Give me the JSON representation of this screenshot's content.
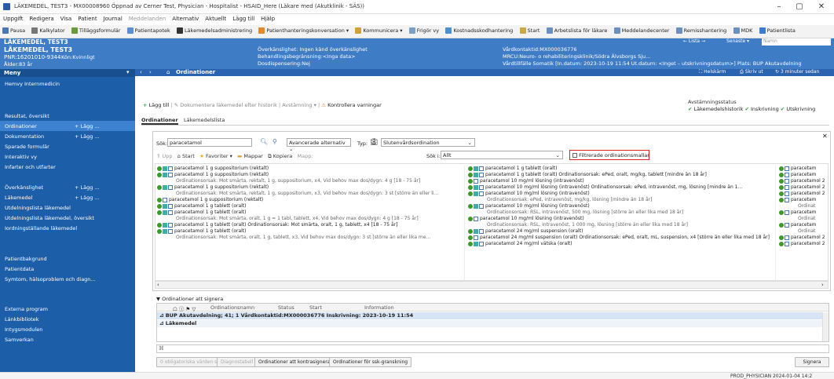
{
  "window": {
    "title": "LÄKEMEDEL, TEST3 - MX00008960 Öppnad av Cerner Test, Physician - Hospitalist - HSAID_Here (Läkare med (Akutklinik - SÄS))",
    "min": "–",
    "max": "▢",
    "close": "✕"
  },
  "menubar": {
    "items": [
      "Uppgift",
      "Redigera",
      "Visa",
      "Patient",
      "Journal"
    ],
    "disabled": "Meddelanden",
    "items2": [
      "Alternativ",
      "Aktuellt",
      "Lägg till",
      "Hjälp"
    ]
  },
  "toolbar": {
    "items": [
      "Pausa",
      "Kalkylator",
      "Tilläggsformulär",
      "Patientapotek",
      "Läkemedelsadministrering",
      "Patienthanteringskonversation ▾",
      "Kommunicera ▾",
      "Frigör vy",
      "Kostnadsskodhantering",
      "Start",
      "Arbetslista för läkare",
      "Meddelandecenter",
      "Remisshantering",
      "MDK",
      "Patientlista"
    ]
  },
  "patient": {
    "title": "LÄKEMEDEL, TEST3",
    "name": "LÄKEMEDEL, TEST3",
    "pnr": "PNR:16201010-9344",
    "gender": "Kön:Kvinnligt",
    "age": "Ålder:83 år",
    "allergy": "Överkänslighet: Ingen känd överkänslighet",
    "limit": "Behandlingsbegränsning:<Inga data>",
    "dosing": "Dosdispensering:Nej",
    "contact": "Vårdkontaktid:MX000036776",
    "unit": "MRCU:Neuro- o rehabiliteringsklinik/Södra Älvsborgs Sju...",
    "episode": "Vårdtillfälle Somatik [In.datum: 2023-10-19 11:54 Ut.datum: <Inget – utskrivningsdatum>] Plats: BUP Akutavdelning",
    "lista": "← Lista →",
    "senaste": "Senaste ▾",
    "namn": "Namn"
  },
  "nav": {
    "title": "Ordinationer",
    "helskarm": "Helskärm",
    "skriv": "Skriv ut",
    "updated": "3 minuter sedan"
  },
  "leftmenu": {
    "header": "Meny",
    "items": [
      {
        "label": "Hemvy Internmedicin",
        "add": ""
      },
      {
        "label": "Resultat, översikt",
        "add": ""
      },
      {
        "label": "Ordinationer",
        "add": "+ Lägg ..."
      },
      {
        "label": "Dokumentation",
        "add": "+ Lägg ..."
      },
      {
        "label": "Sparade formulär",
        "add": ""
      },
      {
        "label": "Interaktiv vy",
        "add": ""
      },
      {
        "label": "Infarter och utfarter",
        "add": ""
      },
      {
        "label": "Överkänslighet",
        "add": "+ Lägg ..."
      },
      {
        "label": "Läkemedel",
        "add": "+ Lägg ..."
      },
      {
        "label": "Utdelningslista läkemedel",
        "add": ""
      },
      {
        "label": "Utdelningslista läkemedel, översikt",
        "add": ""
      },
      {
        "label": "Iordningställande läkemedel",
        "add": ""
      },
      {
        "label": "Patientbakgrund",
        "add": ""
      },
      {
        "label": "Patientdata",
        "add": ""
      },
      {
        "label": "Symtom, hälsoproblem och diagn...",
        "add": ""
      },
      {
        "label": "Externa program",
        "add": ""
      },
      {
        "label": "Länkbibliotek",
        "add": ""
      },
      {
        "label": "Intygsmodulen",
        "add": ""
      },
      {
        "label": "Samverkan",
        "add": ""
      }
    ]
  },
  "actions": {
    "add": "Lägg till",
    "document": "Dokumentera läkemedel efter historik",
    "reconcile": "Avstämning ▾",
    "check": "Kontrollera varningar",
    "status_title": "Avstämningsstatus",
    "status1": "Läkemedelshistorik",
    "status2": "Inskrivning",
    "status3": "Utskrivning"
  },
  "tabs": [
    "Ordinationer",
    "Läkemedelslista"
  ],
  "search": {
    "label": "Sök:",
    "value": "paracetamol",
    "advanced": "Avancerade alternativ",
    "type_label": "Typ:",
    "type_value": "Slutenvårdsordination",
    "upp": "Upp",
    "start": "Start",
    "favoriter": "Favoriter ▾",
    "mappar": "Mappar",
    "kopiera": "Kopiera",
    "mapp": "Mapp:",
    "in_label": "Sök i:",
    "in_value": "Allt",
    "filter": "Filtrerade ordinationsmallar"
  },
  "results": {
    "col1": [
      {
        "t": "paracetamol 1 g suppositorium (rektalt)",
        "sub": false
      },
      {
        "t": "paracetamol 1 g suppositorium (rektalt)",
        "sub": false
      },
      {
        "t": "Ordinationsorsak: Mot smärta, rektalt, 1 g, suppositorium, x4, Vid behov max dos/dygn: 4 g [18 - 75 år]",
        "sub": true
      },
      {
        "t": "paracetamol 1 g suppositorium (rektalt)",
        "sub": false
      },
      {
        "t": "Ordinationsorsak: Mot smärta, rektalt, 1 g, suppositorium, x3, Vid behov max dos/dygn: 3 st [större än eller li...",
        "sub": true
      },
      {
        "t": "paracetamol 1 g suppositorium (rektalt)",
        "sub": false
      },
      {
        "t": "paracetamol 1 g tablett (oralt)",
        "sub": false
      },
      {
        "t": "paracetamol 1 g tablett (oralt)",
        "sub": false
      },
      {
        "t": "Ordinationsorsak: Mot smärta, oralt, 1 g = 1 tabl, tablett, x4, Vid behov max dos/dygn: 4 g [18 - 75 år]",
        "sub": true
      },
      {
        "t": "paracetamol 1 g tablett (oralt)  Ordinationsorsak: Mot smärta, oralt, 1 g, tablett, x4 [18 - 75 år]",
        "sub": false
      },
      {
        "t": "paracetamol 1 g tablett (oralt)",
        "sub": false
      },
      {
        "t": "Ordinationsorsak: Mot smärta, oralt, 1 g, tablett, x3, Vid behov max dos/dygn: 3 st [större än eller lika me...",
        "sub": true
      }
    ],
    "col2": [
      {
        "t": "paracetamol 1 g tablett (oralt)",
        "sub": false
      },
      {
        "t": "paracetamol 1 g tablett (oralt)  Ordinationsorsak: ePed, oralt, mg/kg, tablett [mindre än 18 år]",
        "sub": false
      },
      {
        "t": "paracetamol 10 mg/ml lösning (intravenöst)",
        "sub": false
      },
      {
        "t": "paracetamol 10 mg/ml lösning (intravenöst)  Ordinationsorsak: ePed, intravenöst, mg, lösning [mindre än 1...",
        "sub": false
      },
      {
        "t": "paracetamol 10 mg/ml lösning (intravenöst)",
        "sub": false
      },
      {
        "t": "Ordinationsorsak: ePed, intravenöst, mg/kg, lösning [mindre än 18 år]",
        "sub": true
      },
      {
        "t": "paracetamol 10 mg/ml lösning (intravenöst)",
        "sub": false
      },
      {
        "t": "Ordinationsorsak: RSL, intravenöst, 500 mg, lösning [större än eller lika med 18 år]",
        "sub": true
      },
      {
        "t": "paracetamol 10 mg/ml lösning (intravenöst)",
        "sub": false
      },
      {
        "t": "Ordinationsorsak: RSL, intravenöst, 1 000 mg, lösning [större än eller lika med 18 år]",
        "sub": true
      },
      {
        "t": "paracetamol 24 mg/ml suspension (oralt)",
        "sub": false
      },
      {
        "t": "paracetamol 24 mg/ml suspension (oralt)  Ordinationsorsak: ePed, oralt, mL, suspension, x4 [större än eller lika med 18 år]",
        "sub": false
      },
      {
        "t": "paracetamol 24 mg/ml vätska (oralt)",
        "sub": false
      }
    ],
    "col3": [
      {
        "t": "paracetam",
        "sub": false
      },
      {
        "t": "paracetam",
        "sub": false
      },
      {
        "t": "paracetamol 2",
        "sub": false
      },
      {
        "t": "paracetamol 2",
        "sub": false
      },
      {
        "t": "paracetamol 2",
        "sub": false
      },
      {
        "t": "paracetam",
        "sub": false
      },
      {
        "t": "Ordinat",
        "sub": true
      },
      {
        "t": "paracetam",
        "sub": false
      },
      {
        "t": "Ordinat",
        "sub": true
      },
      {
        "t": "paracetam",
        "sub": false
      },
      {
        "t": "Ordinat",
        "sub": true
      },
      {
        "t": "paracetamol 2",
        "sub": false
      },
      {
        "t": "paracetamol 2",
        "sub": false
      }
    ]
  },
  "sign": {
    "title": "Ordinationer att signera",
    "cols": [
      "Ordinationsnamn",
      "Status",
      "Start",
      "Information"
    ],
    "group": "BUP Akutavdelning; 41; 1 Vårdkontaktid:MX000036776 Inskrivning: 2023-10-19 11:54",
    "sub": "Läkemedel"
  },
  "bottom": {
    "b1": "0 obligatoriska värden saknas",
    "b2": "Diagnostabell",
    "b3": "Ordinationer att kontrasignera",
    "b4": "Ordinationer för ssk-granskning",
    "sign": "Signera"
  },
  "statusbar": "PROD_PHYSICIAN 2024-01-04 14:2"
}
